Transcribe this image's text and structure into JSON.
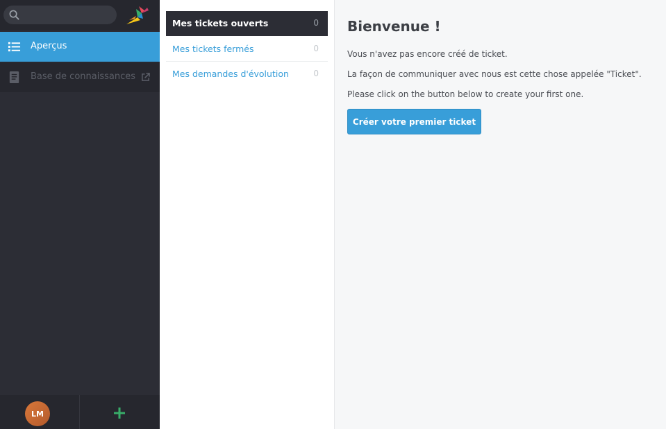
{
  "sidebar": {
    "search": {
      "placeholder": ""
    },
    "nav": {
      "overview": {
        "label": "Aperçus",
        "icon": "list-icon"
      },
      "knowledge_base": {
        "label": "Base de connaissances",
        "icon": "book-icon"
      }
    },
    "footer": {
      "avatar_initials": "LM"
    }
  },
  "ticket_list": {
    "items": [
      {
        "label": "Mes tickets ouverts",
        "count": "0"
      },
      {
        "label": "Mes tickets fermés",
        "count": "0"
      },
      {
        "label": "Mes demandes d'évolution",
        "count": "0"
      }
    ]
  },
  "main": {
    "title": "Bienvenue !",
    "paragraphs": [
      "Vous n'avez pas encore créé de ticket.",
      "La façon de communiquer avec nous est cette chose appelée \"Ticket\".",
      "Please click on the button below to create your first one."
    ],
    "cta_label": "Créer votre premier ticket"
  },
  "colors": {
    "accent": "#389ed9",
    "sidebar_bg": "#2c2d35",
    "add_green": "#38ad69"
  }
}
